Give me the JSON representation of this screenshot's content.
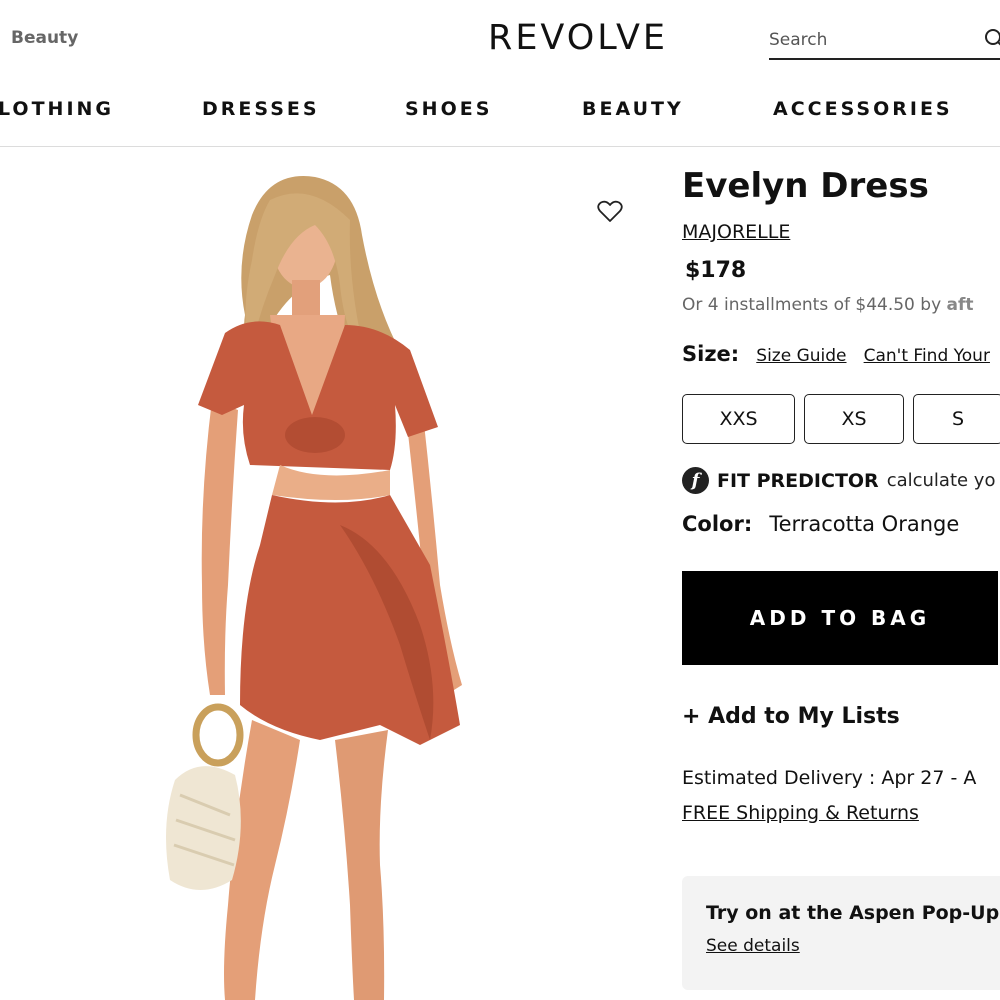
{
  "header": {
    "top_link": "Beauty",
    "logo": "REVOLVE",
    "search_placeholder": "Search",
    "search_icon": "search-icon"
  },
  "nav": {
    "items": [
      "LOTHING",
      "DRESSES",
      "SHOES",
      "BEAUTY",
      "ACCESSORIES"
    ]
  },
  "product": {
    "wishlist_icon": "heart-outline-icon",
    "title": "Evelyn Dress",
    "brand": "MAJORELLE",
    "price": "$178",
    "installments": "Or 4 installments of $44.50 by",
    "installments_provider": "aft",
    "size_label": "Size:",
    "size_guide": "Size Guide",
    "cant_find": "Can't Find Your",
    "sizes": [
      "XXS",
      "XS",
      "S"
    ],
    "fit_icon": "f",
    "fit_predictor": "FIT PREDICTOR",
    "fit_text": "calculate yo",
    "color_label": "Color:",
    "color_value": "Terracotta Orange",
    "add_to_bag": "ADD TO BAG",
    "add_to_lists": "+ Add to My Lists",
    "delivery": "Estimated Delivery : Apr 27 - A",
    "shipping": "FREE Shipping & Returns",
    "popup_title": "Try on at the Aspen Pop-Up",
    "popup_link": "See details"
  },
  "colors": {
    "dress": "#c55a3e",
    "skin": "#e8a67e",
    "hair": "#c9a06a",
    "button_bg": "#000000",
    "panel_bg": "#f3f3f3"
  }
}
